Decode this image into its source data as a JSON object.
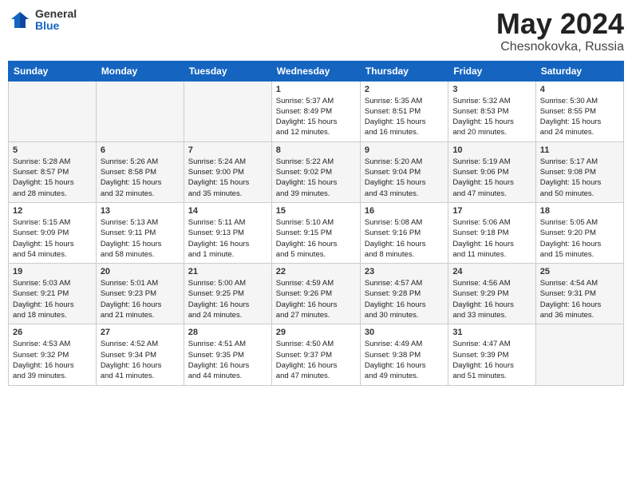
{
  "header": {
    "logo_general": "General",
    "logo_blue": "Blue",
    "title": "May 2024",
    "location": "Chesnokovka, Russia"
  },
  "days_of_week": [
    "Sunday",
    "Monday",
    "Tuesday",
    "Wednesday",
    "Thursday",
    "Friday",
    "Saturday"
  ],
  "weeks": [
    [
      {
        "day": "",
        "info": ""
      },
      {
        "day": "",
        "info": ""
      },
      {
        "day": "",
        "info": ""
      },
      {
        "day": "1",
        "info": "Sunrise: 5:37 AM\nSunset: 8:49 PM\nDaylight: 15 hours\nand 12 minutes."
      },
      {
        "day": "2",
        "info": "Sunrise: 5:35 AM\nSunset: 8:51 PM\nDaylight: 15 hours\nand 16 minutes."
      },
      {
        "day": "3",
        "info": "Sunrise: 5:32 AM\nSunset: 8:53 PM\nDaylight: 15 hours\nand 20 minutes."
      },
      {
        "day": "4",
        "info": "Sunrise: 5:30 AM\nSunset: 8:55 PM\nDaylight: 15 hours\nand 24 minutes."
      }
    ],
    [
      {
        "day": "5",
        "info": "Sunrise: 5:28 AM\nSunset: 8:57 PM\nDaylight: 15 hours\nand 28 minutes."
      },
      {
        "day": "6",
        "info": "Sunrise: 5:26 AM\nSunset: 8:58 PM\nDaylight: 15 hours\nand 32 minutes."
      },
      {
        "day": "7",
        "info": "Sunrise: 5:24 AM\nSunset: 9:00 PM\nDaylight: 15 hours\nand 35 minutes."
      },
      {
        "day": "8",
        "info": "Sunrise: 5:22 AM\nSunset: 9:02 PM\nDaylight: 15 hours\nand 39 minutes."
      },
      {
        "day": "9",
        "info": "Sunrise: 5:20 AM\nSunset: 9:04 PM\nDaylight: 15 hours\nand 43 minutes."
      },
      {
        "day": "10",
        "info": "Sunrise: 5:19 AM\nSunset: 9:06 PM\nDaylight: 15 hours\nand 47 minutes."
      },
      {
        "day": "11",
        "info": "Sunrise: 5:17 AM\nSunset: 9:08 PM\nDaylight: 15 hours\nand 50 minutes."
      }
    ],
    [
      {
        "day": "12",
        "info": "Sunrise: 5:15 AM\nSunset: 9:09 PM\nDaylight: 15 hours\nand 54 minutes."
      },
      {
        "day": "13",
        "info": "Sunrise: 5:13 AM\nSunset: 9:11 PM\nDaylight: 15 hours\nand 58 minutes."
      },
      {
        "day": "14",
        "info": "Sunrise: 5:11 AM\nSunset: 9:13 PM\nDaylight: 16 hours\nand 1 minute."
      },
      {
        "day": "15",
        "info": "Sunrise: 5:10 AM\nSunset: 9:15 PM\nDaylight: 16 hours\nand 5 minutes."
      },
      {
        "day": "16",
        "info": "Sunrise: 5:08 AM\nSunset: 9:16 PM\nDaylight: 16 hours\nand 8 minutes."
      },
      {
        "day": "17",
        "info": "Sunrise: 5:06 AM\nSunset: 9:18 PM\nDaylight: 16 hours\nand 11 minutes."
      },
      {
        "day": "18",
        "info": "Sunrise: 5:05 AM\nSunset: 9:20 PM\nDaylight: 16 hours\nand 15 minutes."
      }
    ],
    [
      {
        "day": "19",
        "info": "Sunrise: 5:03 AM\nSunset: 9:21 PM\nDaylight: 16 hours\nand 18 minutes."
      },
      {
        "day": "20",
        "info": "Sunrise: 5:01 AM\nSunset: 9:23 PM\nDaylight: 16 hours\nand 21 minutes."
      },
      {
        "day": "21",
        "info": "Sunrise: 5:00 AM\nSunset: 9:25 PM\nDaylight: 16 hours\nand 24 minutes."
      },
      {
        "day": "22",
        "info": "Sunrise: 4:59 AM\nSunset: 9:26 PM\nDaylight: 16 hours\nand 27 minutes."
      },
      {
        "day": "23",
        "info": "Sunrise: 4:57 AM\nSunset: 9:28 PM\nDaylight: 16 hours\nand 30 minutes."
      },
      {
        "day": "24",
        "info": "Sunrise: 4:56 AM\nSunset: 9:29 PM\nDaylight: 16 hours\nand 33 minutes."
      },
      {
        "day": "25",
        "info": "Sunrise: 4:54 AM\nSunset: 9:31 PM\nDaylight: 16 hours\nand 36 minutes."
      }
    ],
    [
      {
        "day": "26",
        "info": "Sunrise: 4:53 AM\nSunset: 9:32 PM\nDaylight: 16 hours\nand 39 minutes."
      },
      {
        "day": "27",
        "info": "Sunrise: 4:52 AM\nSunset: 9:34 PM\nDaylight: 16 hours\nand 41 minutes."
      },
      {
        "day": "28",
        "info": "Sunrise: 4:51 AM\nSunset: 9:35 PM\nDaylight: 16 hours\nand 44 minutes."
      },
      {
        "day": "29",
        "info": "Sunrise: 4:50 AM\nSunset: 9:37 PM\nDaylight: 16 hours\nand 47 minutes."
      },
      {
        "day": "30",
        "info": "Sunrise: 4:49 AM\nSunset: 9:38 PM\nDaylight: 16 hours\nand 49 minutes."
      },
      {
        "day": "31",
        "info": "Sunrise: 4:47 AM\nSunset: 9:39 PM\nDaylight: 16 hours\nand 51 minutes."
      },
      {
        "day": "",
        "info": ""
      }
    ]
  ]
}
